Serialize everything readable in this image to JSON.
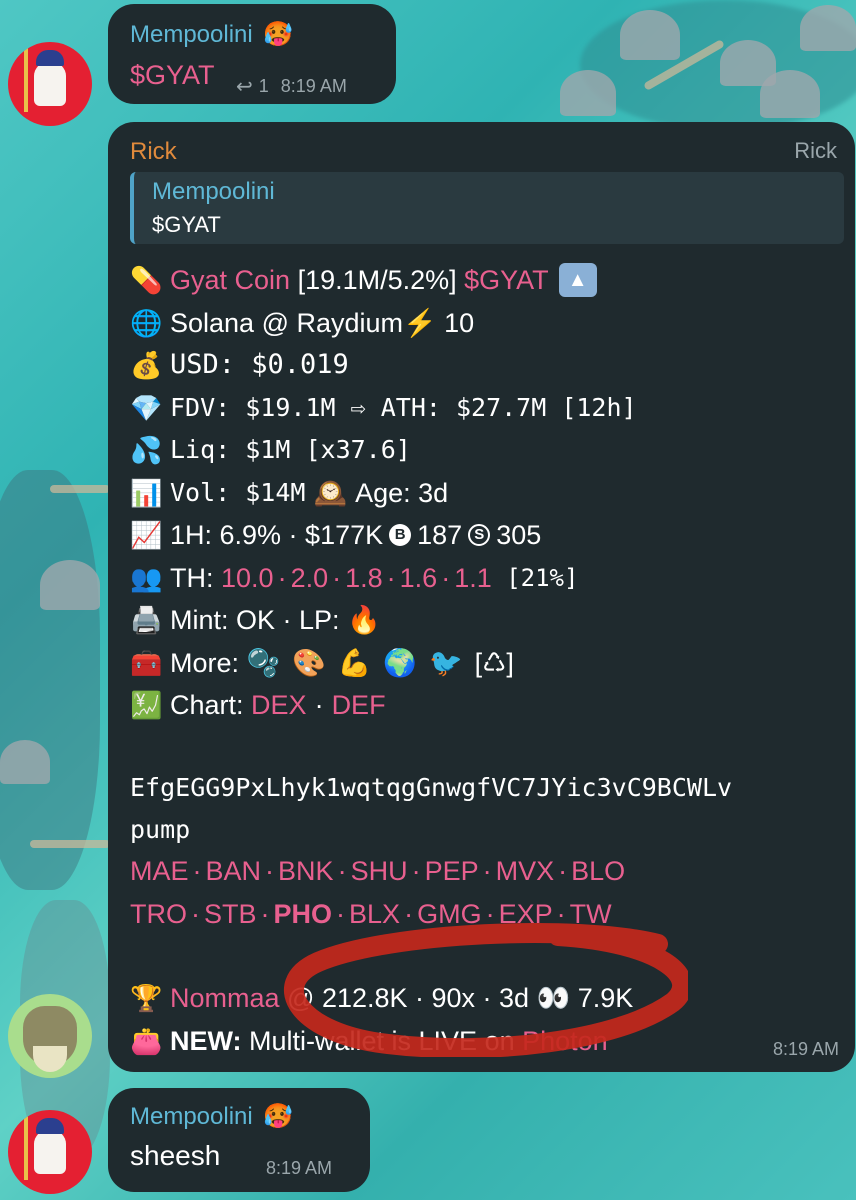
{
  "messages": [
    {
      "author": "Mempoolini",
      "author_emoji": "🥵",
      "text": "$GYAT",
      "reply_count": "1",
      "time": "8:19 AM"
    }
  ],
  "rick_message": {
    "author": "Rick",
    "author_right": "Rick",
    "quote": {
      "author": "Mempoolini",
      "text": "$GYAT"
    },
    "token_line": {
      "name": "Gyat Coin",
      "stats": " [19.1M/5.2%] ",
      "ticker": "$GYAT",
      "emoji": "💊",
      "end_icon": "▲"
    },
    "lines": [
      {
        "emoji": "🌐",
        "text": "Solana @ Raydium⚡ 10"
      },
      {
        "emoji": "💰",
        "text": "USD: $0.019"
      },
      {
        "emoji": "💎",
        "text": "FDV: $19.1M ⇨ ATH: $27.7M [12h]"
      },
      {
        "emoji": "💦",
        "text": "Liq: $1M [x37.6]"
      }
    ],
    "vol_line": {
      "emoji": "📊",
      "vol": "Vol: $14M",
      "age_emoji": "🕰️",
      "age": "Age: 3d"
    },
    "h1_line": {
      "emoji": "📈",
      "text": "1H: 6.9% · $177K",
      "b_label": "B",
      "b_value": "187",
      "s_label": "S",
      "s_value": "305"
    },
    "th_line": {
      "emoji": "👥",
      "label": "TH: ",
      "values": [
        "10.0",
        "2.0",
        "1.8",
        "1.6",
        "1.1"
      ],
      "suffix": " [21%]"
    },
    "mint_line": {
      "emoji": "🖨️",
      "text": "Mint: OK · LP: ",
      "end_emoji": "🔥"
    },
    "more_line": {
      "emoji": "🧰",
      "label": "More: ",
      "icons": [
        "🫧",
        "🎨",
        "💪",
        "🌍",
        "🐦"
      ],
      "end": "[♺]"
    },
    "chart_line": {
      "emoji": "💹",
      "label": "Chart: ",
      "links": [
        "DEX",
        "DEF"
      ]
    },
    "address": "EfgEGG9PxLhyk1wqtqgGnwgfVC7JYic3vC9BCWLv",
    "address_tail": "pump",
    "link_rows": [
      [
        "MAE",
        "BAN",
        "BNK",
        "SHU",
        "PEP",
        "MVX",
        "BLO"
      ],
      [
        "TRO",
        "STB",
        "PHO",
        "BLX",
        "GMG",
        "EXP",
        "TW"
      ]
    ],
    "trophy_line": {
      "emoji": "🏆",
      "name": "Nommaa",
      "text": " @ 212.8K · 90x · 3d ",
      "eyes": "👀",
      "tail": " 7.9K"
    },
    "new_line": {
      "emoji": "👛",
      "label": "NEW:",
      "text": " Multi-wallet is LIVE on ",
      "link": "Photon"
    },
    "time": "8:19 AM"
  },
  "last_message": {
    "author": "Mempoolini",
    "author_emoji": "🥵",
    "text": "sheesh",
    "time": "8:19 AM"
  },
  "colors": {
    "bubble": "#1f2a2e",
    "link": "#e8608f",
    "mempoolini": "#5fb8d6",
    "rick": "#e08a3c",
    "annotation": "#c4281c"
  }
}
